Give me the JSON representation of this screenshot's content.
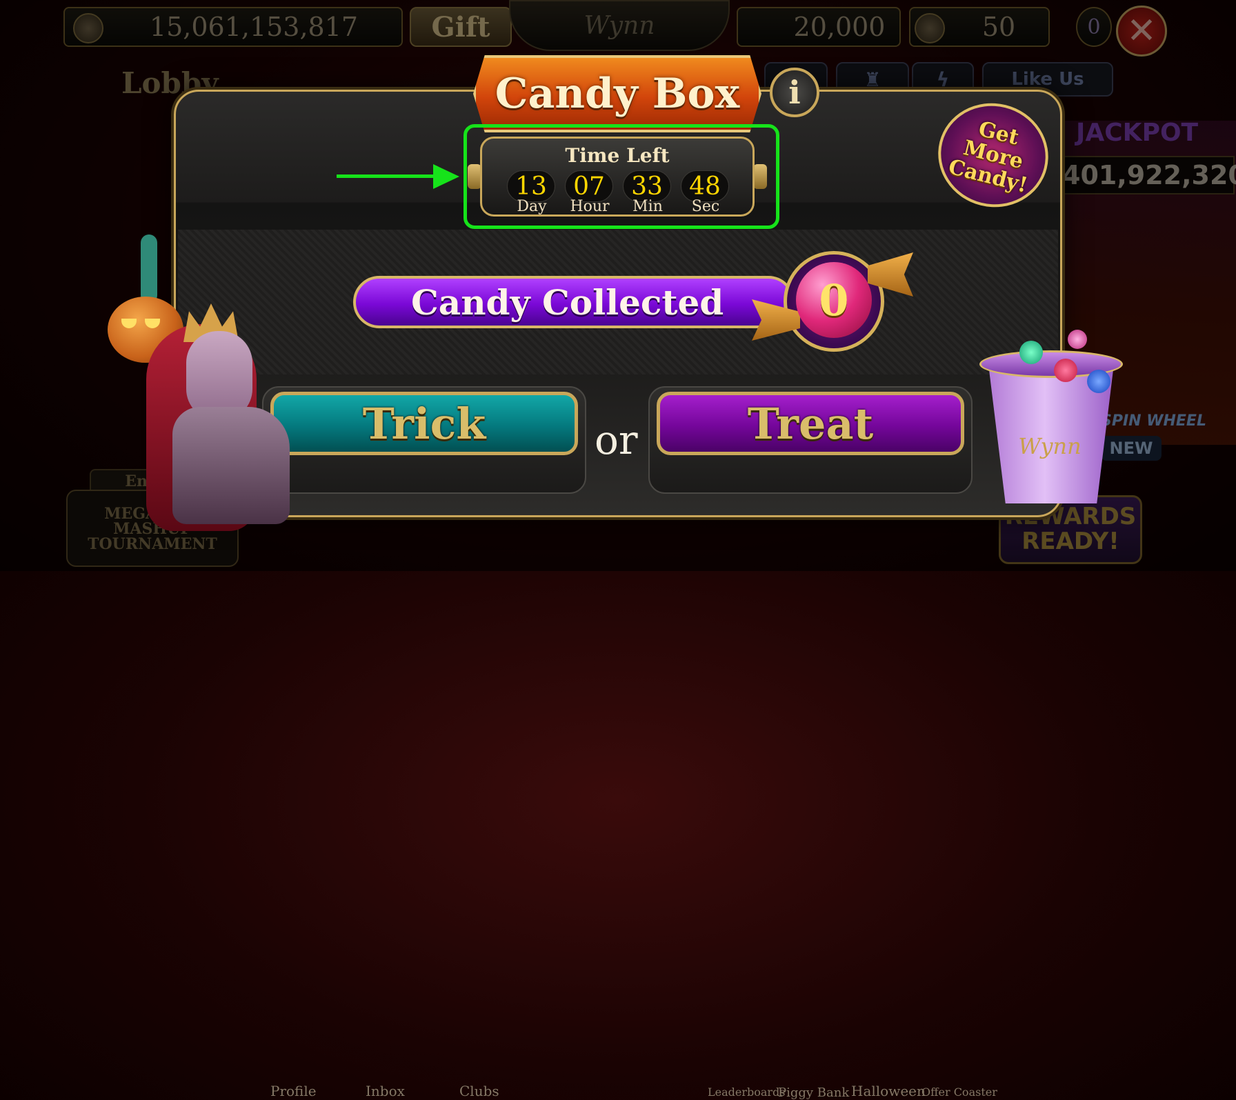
{
  "topbar": {
    "coins": "15,061,153,817",
    "gift_label": "Gift",
    "logo": "Wynn",
    "gems": "20,000",
    "level": "50",
    "vip": "0",
    "close": "✕"
  },
  "lobby": {
    "title": "Lobby",
    "jackpot_label": "JACKPOT",
    "jackpot_amount": "401,922,320",
    "like_us": "Like Us",
    "spin_wheel": "SPIN WHEEL",
    "new_badge": "NEW",
    "rewards": "REWARDS READY!",
    "ended_tag": "Ended",
    "tournament": "MEGA WIN MASHUP TOURNAMENT",
    "nav": [
      "Profile",
      "Inbox",
      "Clubs",
      "Leaderboards",
      "Piggy Bank",
      "Halloween",
      "Offer Coaster"
    ]
  },
  "modal": {
    "title": "Candy Box",
    "info": "i",
    "get_more": "Get More Candy!",
    "timer": {
      "title": "Time Left",
      "units": [
        {
          "value": "13",
          "label": "Day"
        },
        {
          "value": "07",
          "label": "Hour"
        },
        {
          "value": "33",
          "label": "Min"
        },
        {
          "value": "48",
          "label": "Sec"
        }
      ]
    },
    "collected_label": "Candy Collected",
    "collected_count": "0",
    "trick_label": "Trick",
    "or_label": "or",
    "treat_label": "Treat",
    "bucket_logo": "Wynn"
  },
  "colors": {
    "highlight": "#16e31a",
    "timer_digits": "#ffd600",
    "trick": "#04797e",
    "treat": "#74069a",
    "title_plate": "#d2450b"
  }
}
